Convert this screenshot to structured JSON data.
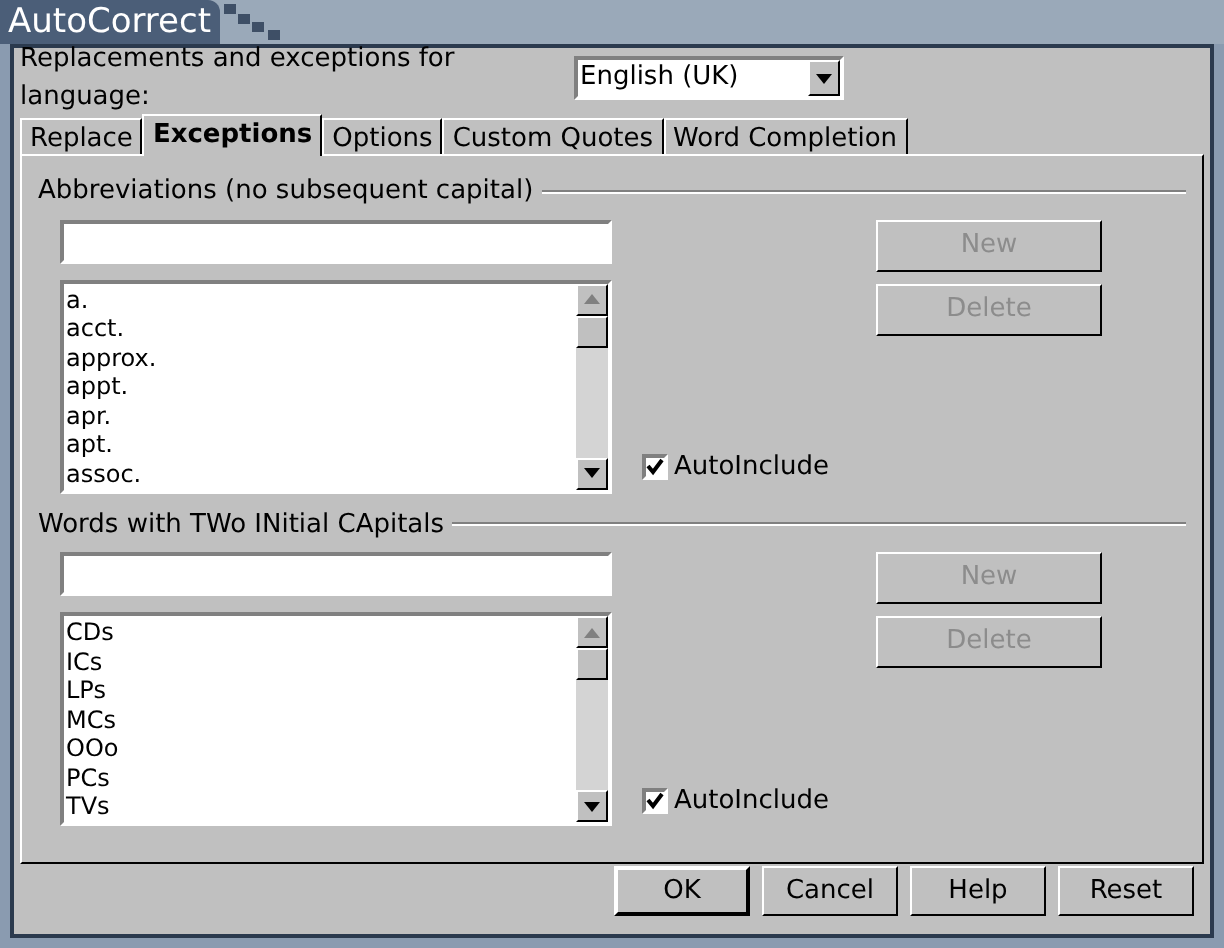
{
  "window": {
    "title": "AutoCorrect"
  },
  "language": {
    "label": "Replacements and exceptions for language:",
    "value": "English (UK)"
  },
  "tabs": [
    {
      "label": "Replace",
      "selected": false
    },
    {
      "label": "Exceptions",
      "selected": true
    },
    {
      "label": "Options",
      "selected": false
    },
    {
      "label": "Custom Quotes",
      "selected": false
    },
    {
      "label": "Word Completion",
      "selected": false
    }
  ],
  "sections": [
    {
      "title": "Abbreviations (no subsequent capital)",
      "items": [
        "a.",
        "acct.",
        "approx.",
        "appt.",
        "apr.",
        "apt.",
        "assoc."
      ],
      "buttons": [
        {
          "label": "New",
          "disabled": true
        },
        {
          "label": "Delete",
          "disabled": true
        }
      ],
      "checkbox": {
        "label": "AutoInclude",
        "checked": true
      }
    },
    {
      "title": "Words with TWo INitial CApitals",
      "items": [
        "CDs",
        "ICs",
        "LPs",
        "MCs",
        "OOo",
        "PCs",
        "TVs"
      ],
      "buttons": [
        {
          "label": "New",
          "disabled": true
        },
        {
          "label": "Delete",
          "disabled": true
        }
      ],
      "checkbox": {
        "label": "AutoInclude",
        "checked": true
      }
    }
  ],
  "footer_buttons": [
    {
      "label": "OK",
      "default": true
    },
    {
      "label": "Cancel",
      "default": false
    },
    {
      "label": "Help",
      "default": false
    },
    {
      "label": "Reset",
      "default": false
    }
  ]
}
